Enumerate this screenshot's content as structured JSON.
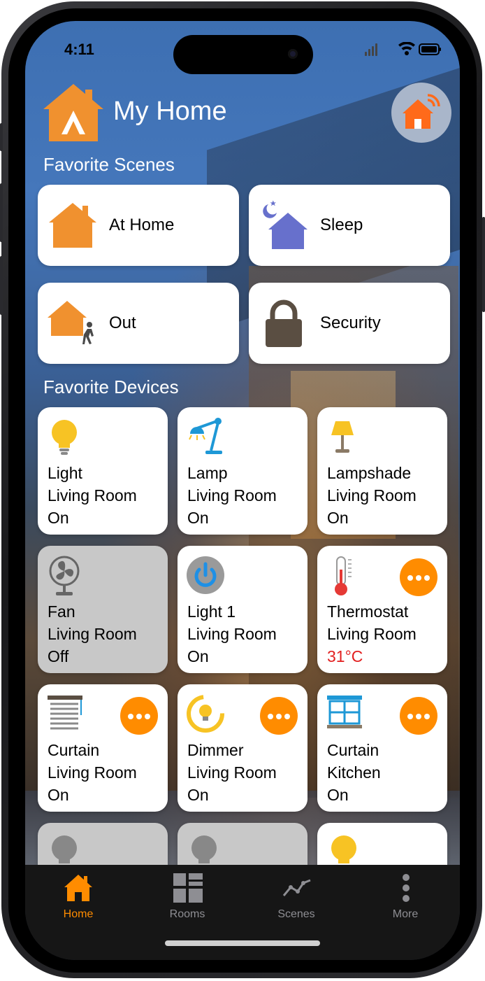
{
  "status_bar": {
    "time": "4:11"
  },
  "header": {
    "title": "My Home",
    "logo_icon": "home-logo-icon",
    "hub_icon": "home-wifi-icon"
  },
  "sections": {
    "scenes_title": "Favorite Scenes",
    "devices_title": "Favorite Devices"
  },
  "scenes": [
    {
      "label": "At Home",
      "icon": "house-icon"
    },
    {
      "label": "Sleep",
      "icon": "night-house-icon"
    },
    {
      "label": "Out",
      "icon": "walking-person-house-icon"
    },
    {
      "label": "Security",
      "icon": "padlock-icon"
    }
  ],
  "devices": [
    {
      "name": "Light",
      "room": "Living Room",
      "state": "On",
      "icon": "light-bulb-icon",
      "active": true
    },
    {
      "name": "Lamp",
      "room": "Living Room",
      "state": "On",
      "icon": "desk-lamp-icon",
      "active": true
    },
    {
      "name": "Lampshade",
      "room": "Living Room",
      "state": "On",
      "icon": "lampshade-icon",
      "active": true
    },
    {
      "name": "Fan",
      "room": "Living Room",
      "state": "Off",
      "icon": "fan-icon",
      "active": false
    },
    {
      "name": "Light 1",
      "room": "Living Room",
      "state": "On",
      "icon": "power-icon",
      "active": true
    },
    {
      "name": "Thermostat",
      "room": "Living Room",
      "state": "31°C",
      "icon": "thermometer-icon",
      "active": true,
      "has_more": true
    },
    {
      "name": "Curtain",
      "room": "Living Room",
      "state": "On",
      "icon": "blind-icon",
      "active": true,
      "has_more": true
    },
    {
      "name": "Dimmer",
      "room": "Living Room",
      "state": "On",
      "icon": "dimmer-bulb-icon",
      "active": true,
      "has_more": true
    },
    {
      "name": "Curtain",
      "room": "Kitchen",
      "state": "On",
      "icon": "window-curtain-icon",
      "active": true,
      "has_more": true
    }
  ],
  "tabs": [
    {
      "label": "Home",
      "icon": "home-tab-icon",
      "active": true
    },
    {
      "label": "Rooms",
      "icon": "rooms-grid-icon",
      "active": false
    },
    {
      "label": "Scenes",
      "icon": "scenes-chart-icon",
      "active": false
    },
    {
      "label": "More",
      "icon": "more-dots-icon",
      "active": false
    }
  ],
  "colors": {
    "accent": "#FF8C00",
    "scene_house": "#F0912F",
    "sleep_house": "#6770CC",
    "hot_text": "#E21F1F"
  }
}
